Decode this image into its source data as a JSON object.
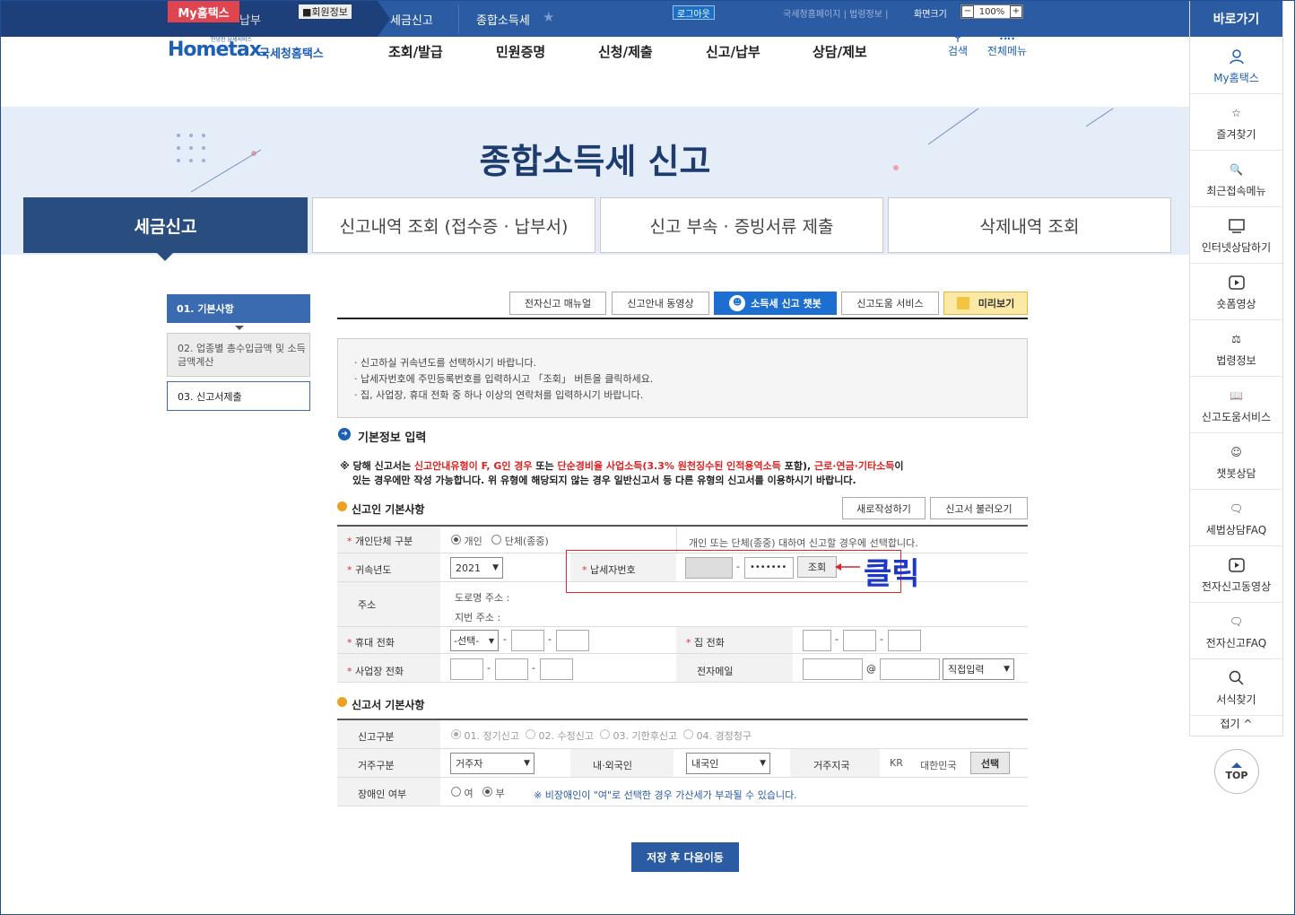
{
  "top": {
    "myhometax": "My홈택스",
    "prev_crumb": "납부",
    "member_info": "회원정보",
    "crumb1": "세금신고",
    "crumb2": "종합소득세",
    "logout": "로그아웃",
    "links": "국세청홈페이지 | 법령정보 |",
    "screen_size": "화면크기",
    "zoom": "100%"
  },
  "logo": {
    "small": "안녕한 납세서비스",
    "brand": "Hometax.",
    "name": "국세청홈택스"
  },
  "gnb": [
    "조회/발급",
    "민원증명",
    "신청/제출",
    "신고/납부",
    "상담/제보"
  ],
  "gnb_right": {
    "search": "검색",
    "allmenu": "전체메뉴"
  },
  "hero": {
    "title": "종합소득세 신고"
  },
  "tabs": [
    "세금신고",
    "신고내역 조회 (접수증 · 납부서)",
    "신고 부속 · 증빙서류 제출",
    "삭제내역 조회"
  ],
  "steps": [
    "01. 기본사항",
    "02. 업종별 총수입금액 및 소득금액계산",
    "03. 신고서제출"
  ],
  "toolbar": {
    "manual": "전자신고 매뉴얼",
    "video": "신고안내 동영상",
    "chatbot": "소득세 신고 챗봇",
    "help": "신고도움 서비스",
    "preview": "미리보기"
  },
  "notice": [
    "신고하실 귀속년도를 선택하시기 바랍니다.",
    "납세자번호에 주민등록번호를 입력하시고 「조회」 버튼을 클릭하세요.",
    "집, 사업장, 휴대 전화 중 하나 이상의 연락처를 입력하시기 바랍니다."
  ],
  "basic": {
    "title": "기본정보 입력",
    "warn_a": "※ 당해 신고서는 ",
    "warn_b": "신고안내유형이 F, G인 경우",
    "warn_c": " 또는 ",
    "warn_d": "단순경비율 사업소득(3.3% 원천징수된 인적용역소득",
    "warn_e": " 포함), ",
    "warn_f": "근로·연금·기타소득",
    "warn_g": "이",
    "warn_line2": "있는 경우에만 작성 가능합니다. 위 유형에 해당되지 않는 경우 일반신고서 등 다른 유형의 신고서를 이용하시기 바랍니다."
  },
  "filer": {
    "title": "신고인 기본사항",
    "new_btn": "새로작성하기",
    "load_btn": "신고서 불러오기",
    "type_label": "개인단체 구분",
    "type_opts": [
      "개인",
      "단체(종중)"
    ],
    "type_hint": "개인 또는 단체(종중) 대하여 신고할 경우에 선택합니다.",
    "year_label": "귀속년도",
    "year": "2021",
    "taxno_label": "납세자번호",
    "taxno_masked": "•••••••",
    "lookup_btn": "조회",
    "click": "클릭",
    "addr_label": "주소",
    "addr_road": "도로명 주소 :",
    "addr_lot": "지번 주소 :",
    "mobile_label": "휴대 전화",
    "mobile_select": "-선택-",
    "home_label": "집 전화",
    "work_label": "사업장 전화",
    "email_label": "전자메일",
    "email_at": "@",
    "email_domain": "직접입력"
  },
  "report": {
    "title": "신고서 기본사항",
    "kind_label": "신고구분",
    "kinds": [
      "01. 정기신고",
      "02. 수정신고",
      "03. 기한후신고",
      "04. 경정청구"
    ],
    "res_label": "거주구분",
    "res": "거주자",
    "nat_label": "내·외국인",
    "nat": "내국인",
    "country_label": "거주지국",
    "country_code": "KR",
    "country_name": "대한민국",
    "select_btn": "선택",
    "disab_label": "장애인 여부",
    "disab_opts": [
      "여",
      "부"
    ],
    "disab_note": "※ 비장애인이 \"여\"로 선택한 경우 가산세가 부과될 수 있습니다."
  },
  "save_btn": "저장 후 다음이동",
  "sidebar": {
    "title": "바로가기",
    "items": [
      "My홈택스",
      "즐겨찾기",
      "최근접속메뉴",
      "인터넷상담하기",
      "숏폼영상",
      "법령정보",
      "신고도움서비스",
      "챗봇상담",
      "세법상담FAQ",
      "전자신고동영상",
      "전자신고FAQ",
      "서식찾기"
    ],
    "fold": "접기 ^",
    "top": "TOP"
  }
}
